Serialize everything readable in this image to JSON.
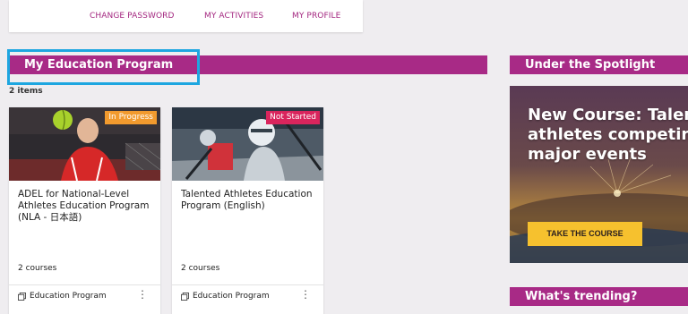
{
  "nav": {
    "change_password": "CHANGE PASSWORD",
    "my_activities": "MY ACTIVITIES",
    "my_profile": "MY PROFILE"
  },
  "education": {
    "title": "My Education Program",
    "count": "2 items",
    "cards": [
      {
        "badge": "In Progress",
        "title": "ADEL for National-Level Athletes Education Program (NLA - 日本語)",
        "courses": "2 courses",
        "type": "Education Program"
      },
      {
        "badge": "Not Started",
        "title": "Talented Athletes Education Program (English)",
        "courses": "2 courses",
        "type": "Education Program"
      }
    ]
  },
  "spotlight": {
    "title": "Under the Spotlight",
    "headline": "New Course: Talented athletes competing at major events",
    "button": "TAKE THE COURSE"
  },
  "trending": {
    "title": "What's trending?"
  },
  "colors": {
    "brand": "#a82a86",
    "focus": "#1ea6e0",
    "in_progress": "#f29a2e",
    "not_started": "#d9255d",
    "cta": "#f6c12e"
  }
}
